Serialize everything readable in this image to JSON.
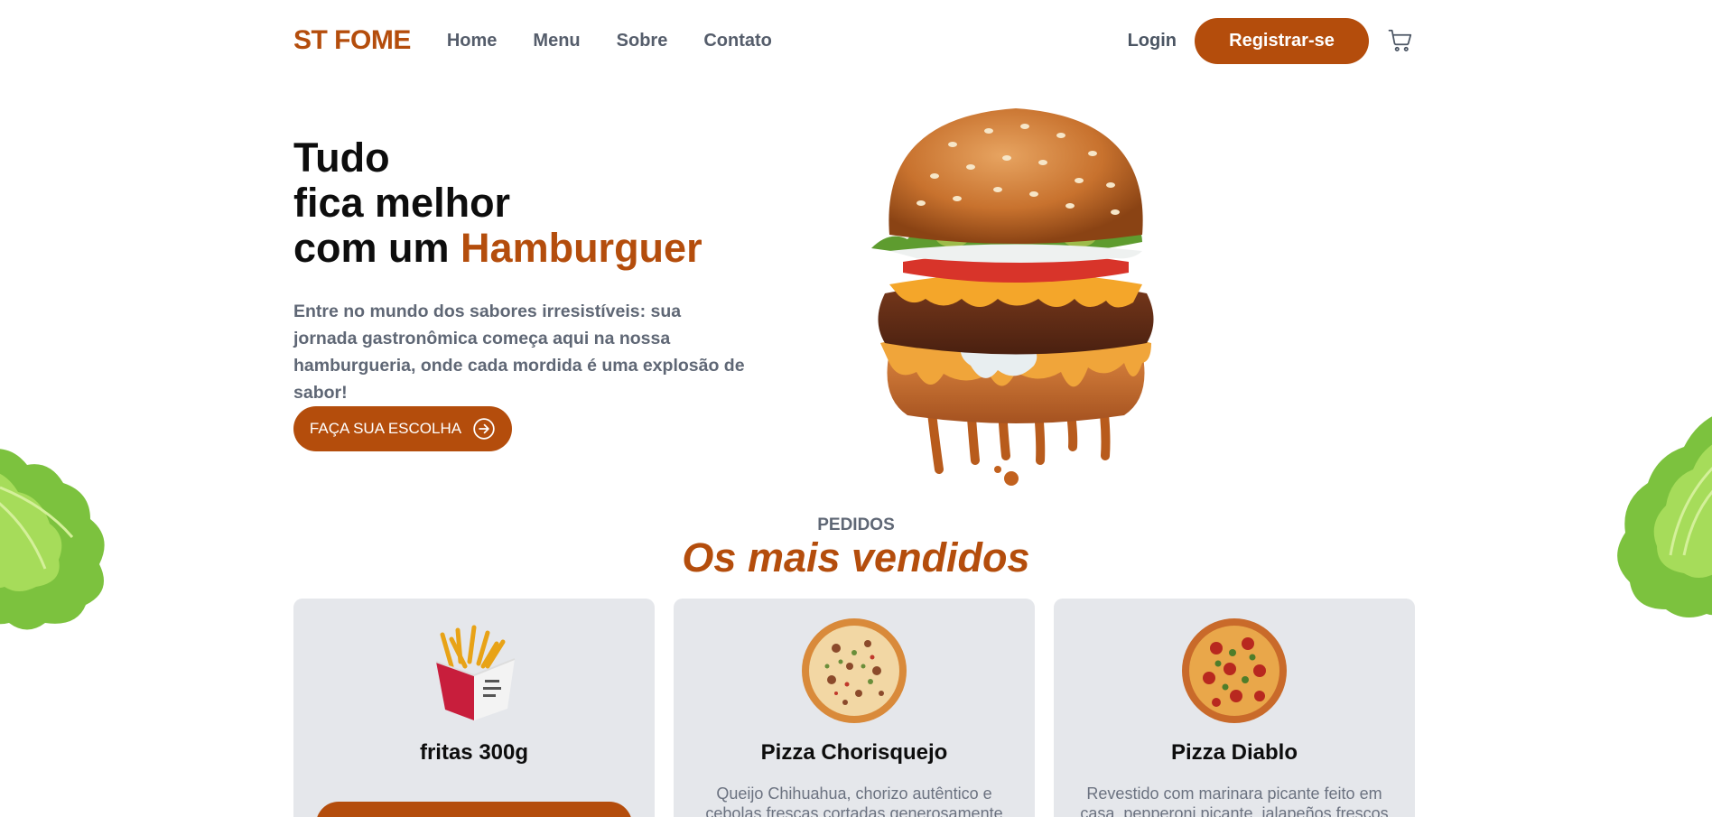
{
  "header": {
    "logo": "ST FOME",
    "nav": [
      "Home",
      "Menu",
      "Sobre",
      "Contato"
    ],
    "login": "Login",
    "register": "Registrar-se",
    "cart_icon": "cart-icon"
  },
  "hero": {
    "line1": "Tudo",
    "line2": "fica melhor",
    "line3_prefix": "com um ",
    "line3_accent": "Hamburguer",
    "description": "Entre no mundo dos sabores irresistíveis: sua jornada gastronômica começa aqui na nossa hamburgueria, onde cada mordida é uma explosão de sabor!",
    "cta": "FAÇA SUA ESCOLHA"
  },
  "section": {
    "kicker": "PEDIDOS",
    "title": "Os mais vendidos"
  },
  "cards": [
    {
      "title": "fritas 300g",
      "description": ""
    },
    {
      "title": "Pizza Chorisquejo",
      "description": "Queijo Chihuahua, chorizo autêntico e cebolas frescas cortadas generosamente espalhadas"
    },
    {
      "title": "Pizza Diablo",
      "description": "Revestido com marinara picante feito em casa, pepperoni picante, jalapeños frescos"
    }
  ],
  "colors": {
    "accent": "#b44d0c",
    "card_bg": "#e5e7eb",
    "muted_text": "#5f6775"
  }
}
